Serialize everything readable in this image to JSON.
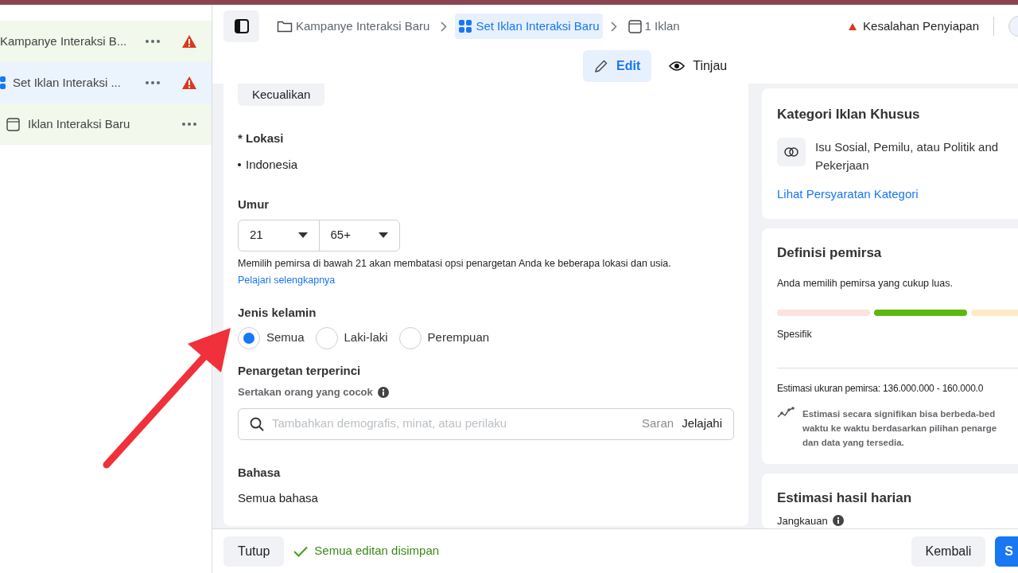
{
  "sidebar": {
    "items": [
      {
        "label": "Kampanye Interaksi B...",
        "kind": "campaign",
        "selected": false,
        "warning": true
      },
      {
        "label": "Set Iklan Interaksi ...",
        "kind": "adset",
        "selected": true,
        "warning": true
      },
      {
        "label": "Iklan Interaksi Baru",
        "kind": "ad",
        "selected": false,
        "warning": false
      }
    ]
  },
  "breadcrumbs": [
    {
      "label": "Kampanye Interaksi Baru",
      "kind": "campaign",
      "selected": false
    },
    {
      "label": "Set Iklan Interaksi Baru",
      "kind": "adset",
      "selected": true
    },
    {
      "label": "1 Iklan",
      "kind": "ad",
      "selected": false
    }
  ],
  "status": {
    "label": "Kesalahan Penyiapan"
  },
  "mode_tabs": [
    {
      "label": "Edit",
      "kind": "edit",
      "selected": true
    },
    {
      "label": "Tinjau",
      "kind": "review",
      "selected": false
    }
  ],
  "form": {
    "exclude_button": "Kecualikan",
    "location": {
      "label": "* Lokasi",
      "items": [
        "Indonesia"
      ]
    },
    "age": {
      "label": "Umur",
      "min": "21",
      "max": "65+",
      "note": "Memilih pemirsa di bawah 21 akan membatasi opsi penargetan Anda ke beberapa lokasi dan usia.",
      "link": "Pelajari selengkapnya"
    },
    "gender": {
      "label": "Jenis kelamin",
      "options": [
        {
          "label": "Semua",
          "selected": true
        },
        {
          "label": "Laki-laki",
          "selected": false
        },
        {
          "label": "Perempuan",
          "selected": false
        }
      ]
    },
    "detailed": {
      "label": "Penargetan terperinci",
      "sublabel": "Sertakan orang yang cocok",
      "placeholder": "Tambahkan demografis, minat, atau perilaku",
      "suggest": "Saran",
      "browse": "Jelajahi"
    },
    "language": {
      "label": "Bahasa",
      "value": "Semua bahasa"
    }
  },
  "special_category": {
    "title": "Kategori Iklan Khusus",
    "text": "Isu Sosial, Pemilu, atau Politik and Pekerjaan",
    "link": "Lihat Persyaratan Kategori"
  },
  "audience": {
    "title": "Definisi pemirsa",
    "text": "Anda memilih pemirsa yang cukup luas.",
    "segments": [
      {
        "color": "#fde2de"
      },
      {
        "color": "#5cb80f"
      },
      {
        "color": "#fdebc6"
      }
    ],
    "scale_label": "Spesifik",
    "size": "Estimasi ukuran pemirsa: 136.000.000 - 160.000.0",
    "note_lines": [
      "Estimasi secara signifikan bisa berbeda-bed",
      "waktu ke waktu berdasarkan pilihan penarge",
      "dan data yang tersedia."
    ]
  },
  "daily_results": {
    "title": "Estimasi hasil harian",
    "reach_label": "Jangkauan"
  },
  "footer": {
    "close": "Tutup",
    "saved": "Semua editan disimpan",
    "back": "Kembali",
    "next": "S"
  }
}
